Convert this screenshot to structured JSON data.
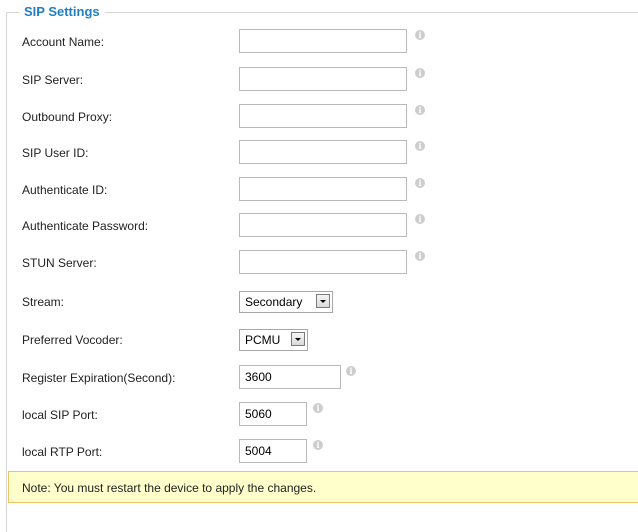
{
  "section": {
    "legend": "SIP Settings"
  },
  "fields": {
    "account_name": {
      "label": "Account Name:",
      "value": ""
    },
    "sip_server": {
      "label": "SIP Server:",
      "value": ""
    },
    "outbound_proxy": {
      "label": "Outbound Proxy:",
      "value": ""
    },
    "sip_user_id": {
      "label": "SIP User ID:",
      "value": ""
    },
    "authenticate_id": {
      "label": "Authenticate ID:",
      "value": ""
    },
    "authenticate_password": {
      "label": "Authenticate Password:",
      "value": ""
    },
    "stun_server": {
      "label": "STUN Server:",
      "value": ""
    },
    "stream": {
      "label": "Stream:",
      "selected": "Secondary"
    },
    "preferred_vocoder": {
      "label": "Preferred Vocoder:",
      "selected": "PCMU"
    },
    "register_expiration": {
      "label": "Register Expiration(Second):",
      "value": "3600"
    },
    "local_sip_port": {
      "label": "local SIP Port:",
      "value": "5060"
    },
    "local_rtp_port": {
      "label": "local RTP Port:",
      "value": "5004"
    }
  },
  "icons": {
    "info": "i",
    "info_icon_name": "info-icon",
    "dropdown_icon_name": "dropdown-arrow-icon"
  },
  "note": {
    "text": "Note: You must restart the device to apply the changes."
  },
  "colors": {
    "legend": "#1f7fc4",
    "note_background": "#ffffcc",
    "note_border": "#f0c36d",
    "info_icon": "#cdcdcd"
  }
}
